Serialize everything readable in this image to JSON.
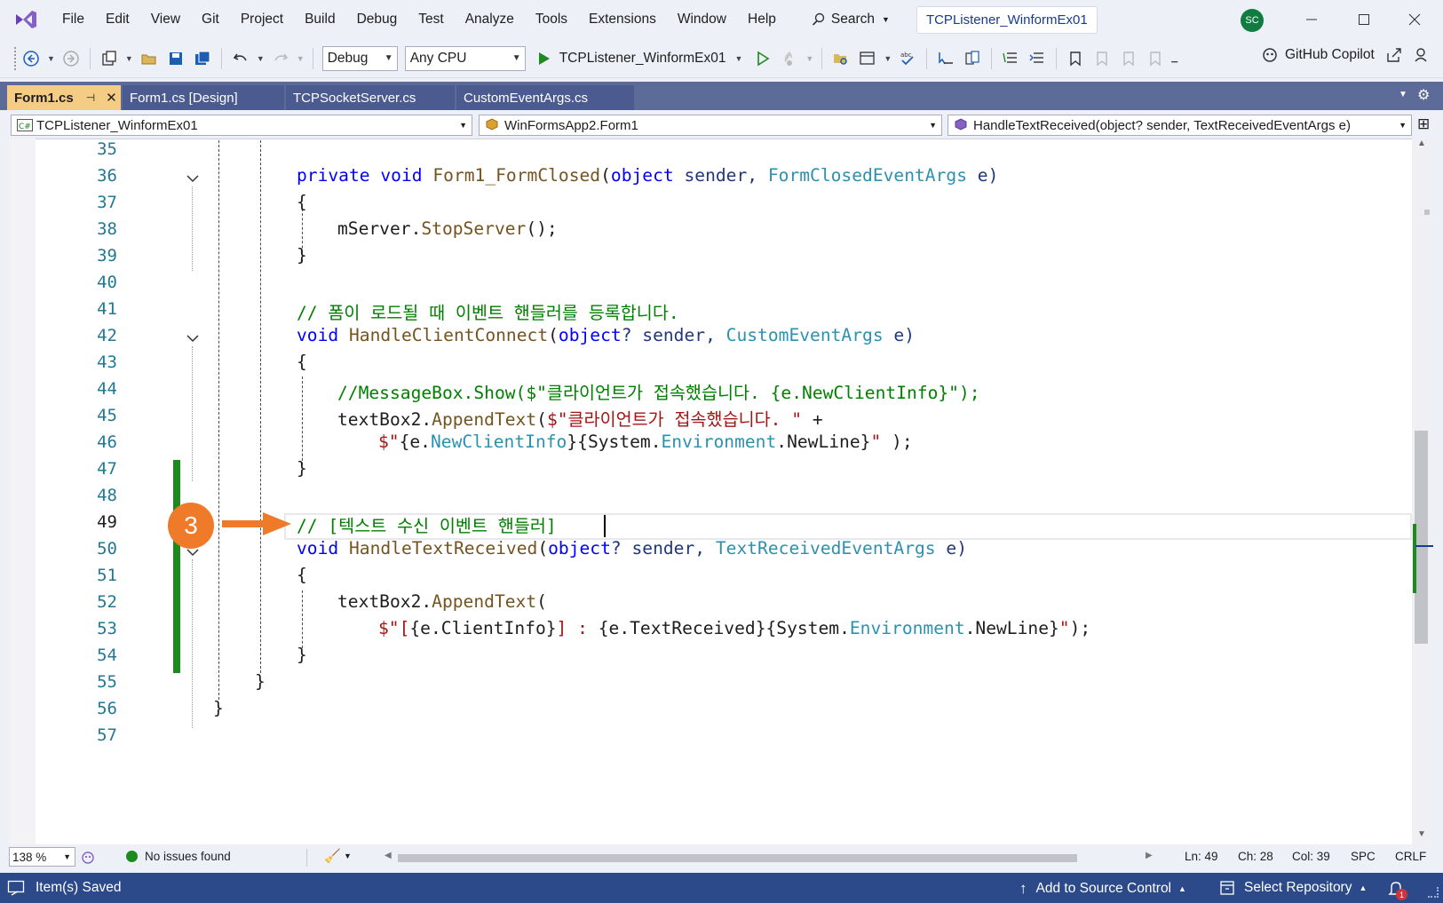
{
  "menu": {
    "items": [
      "File",
      "Edit",
      "View",
      "Git",
      "Project",
      "Build",
      "Debug",
      "Test",
      "Analyze",
      "Tools",
      "Extensions",
      "Window",
      "Help"
    ],
    "search_label": "Search",
    "title": "TCPListener_WinformEx01",
    "profile_initials": "SC"
  },
  "toolbar": {
    "config": "Debug",
    "platform": "Any CPU",
    "run_target": "TCPListener_WinformEx01",
    "copilot_label": "GitHub Copilot"
  },
  "tabs": [
    {
      "label": "Form1.cs",
      "active": true
    },
    {
      "label": "Form1.cs [Design]",
      "active": false
    },
    {
      "label": "TCPSocketServer.cs",
      "active": false
    },
    {
      "label": "CustomEventArgs.cs",
      "active": false
    }
  ],
  "navbar": {
    "project": "TCPListener_WinformEx01",
    "class": "WinFormsApp2.Form1",
    "member": "HandleTextReceived(object? sender, TextReceivedEventArgs e)"
  },
  "editor": {
    "line_numbers": [
      "35",
      "36",
      "37",
      "38",
      "39",
      "40",
      "41",
      "42",
      "43",
      "44",
      "45",
      "46",
      "47",
      "48",
      "49",
      "50",
      "51",
      "52",
      "53",
      "54",
      "55",
      "56",
      "57"
    ],
    "current_line": "49",
    "code": {
      "l36": {
        "a": "private",
        "b": " ",
        "c": "void",
        "d": " ",
        "e": "Form1_FormClosed",
        "f": "(",
        "g": "object",
        "h": " sender, ",
        "i": "FormClosedEventArgs",
        "j": " e)"
      },
      "l37": "{",
      "l38": {
        "a": "mServer",
        "b": ".",
        "c": "StopServer",
        "d": "();"
      },
      "l39": "}",
      "l41": "// 폼이 로드될 때 이벤트 핸들러를 등록합니다.",
      "l42": {
        "a": "void",
        "b": " ",
        "c": "HandleClientConnect",
        "d": "(",
        "e": "object",
        "f": "? sender, ",
        "g": "CustomEventArgs",
        "h": " e)"
      },
      "l43": "{",
      "l44": "//MessageBox.Show($\"클라이언트가 접속했습니다. {e.NewClientInfo}\");",
      "l45": {
        "a": "textBox2",
        "b": ".",
        "c": "AppendText",
        "d": "(",
        "e": "$\"클라이언트가 접속했습니다. \"",
        "f": " +"
      },
      "l46": {
        "a": "$\"",
        "b": "{e.",
        "c": "NewClientInfo",
        "d": "}{",
        "e": "System",
        "f": ".",
        "g": "Environment",
        "h": ".",
        "i": "NewLine",
        "j": "}",
        "k": "\"",
        "l": " );"
      },
      "l47": "}",
      "l49": "// [텍스트 수신 이벤트 핸들러]",
      "l50": {
        "a": "void",
        "b": " ",
        "c": "HandleTextReceived",
        "d": "(",
        "e": "object",
        "f": "? sender, ",
        "g": "TextReceivedEventArgs",
        "h": " e)"
      },
      "l51": "{",
      "l52": {
        "a": "textBox2",
        "b": ".",
        "c": "AppendText",
        "d": "("
      },
      "l53": {
        "a": "$\"[",
        "b": "{e.",
        "c": "ClientInfo",
        "d": "}",
        "e": "] : ",
        "f": "{e.",
        "g": "TextReceived",
        "h": "}{",
        "i": "System",
        "j": ".",
        "k": "Environment",
        "l": ".",
        "m": "NewLine",
        "n": "}",
        "o": "\"",
        "p": ");"
      },
      "l54": "}",
      "l55": "}",
      "l56": "}"
    },
    "annotation_number": "3"
  },
  "editor_status": {
    "zoom": "138 %",
    "issues": "No issues found",
    "ln": "Ln: 49",
    "ch": "Ch: 28",
    "col": "Col: 39",
    "spc": "SPC",
    "crlf": "CRLF"
  },
  "statusbar": {
    "message": "Item(s) Saved",
    "source_control": "Add to Source Control",
    "repository": "Select Repository",
    "notifications": "1"
  },
  "colors": {
    "accent": "#2c4a8a",
    "tab_active": "#f5cc84",
    "annotation": "#ef7a2a",
    "change_bar": "#1d8a1d"
  }
}
